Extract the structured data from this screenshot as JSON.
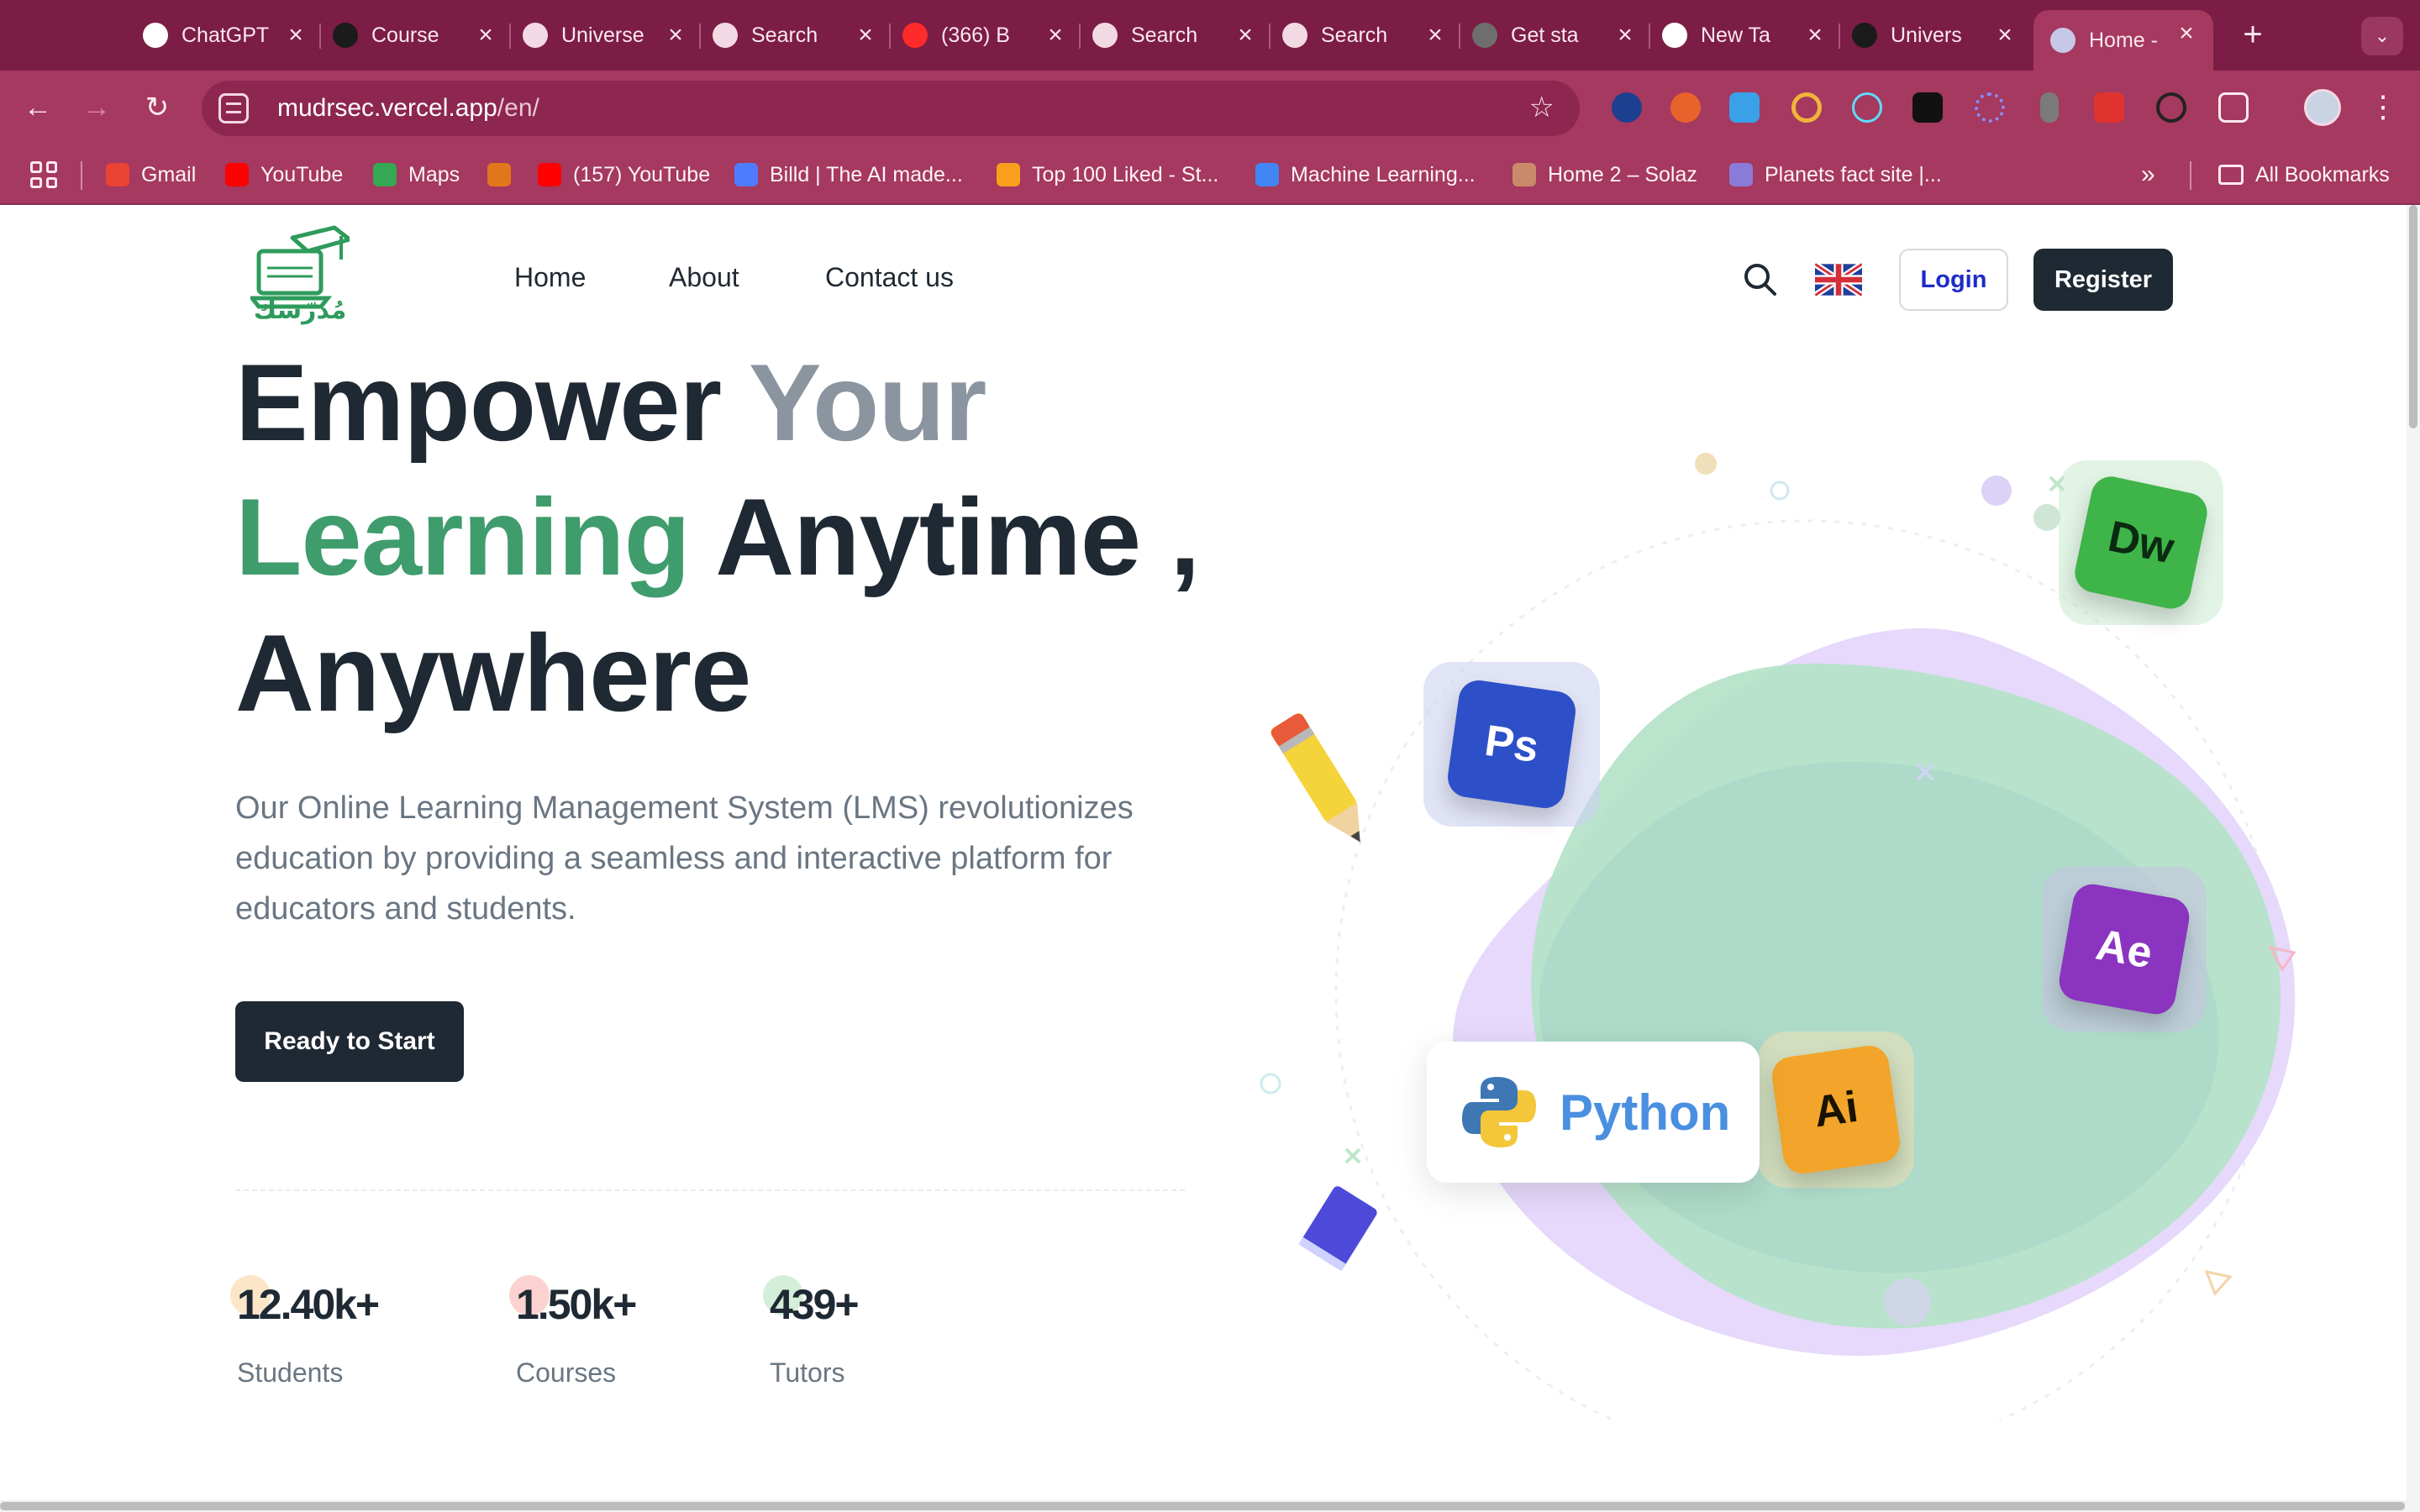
{
  "browser": {
    "tabs": [
      {
        "title": "ChatGPT",
        "favicon": "chatgpt-icon",
        "active": false
      },
      {
        "title": "Course",
        "favicon": "course-icon",
        "active": false
      },
      {
        "title": "Universe",
        "favicon": "openai-icon",
        "active": false
      },
      {
        "title": "Search",
        "favicon": "openai-icon",
        "active": false
      },
      {
        "title": "(366) B",
        "favicon": "youtube-icon",
        "active": false
      },
      {
        "title": "Search",
        "favicon": "openai-icon",
        "active": false
      },
      {
        "title": "Search",
        "favicon": "openai-icon",
        "active": false
      },
      {
        "title": "Get sta",
        "favicon": "globe-icon",
        "active": false
      },
      {
        "title": "New Ta",
        "favicon": "chrome-icon",
        "active": false
      },
      {
        "title": "Univers",
        "favicon": "course-icon",
        "active": false
      },
      {
        "title": "Home -",
        "favicon": "mudrsec-icon",
        "active": true
      }
    ],
    "url_host": "mudrsec.vercel.app",
    "url_path": "/en/",
    "bookmarks": [
      {
        "label": "Gmail",
        "icon": "gmail-icon",
        "color": "#ea4335"
      },
      {
        "label": "YouTube",
        "icon": "youtube-icon",
        "color": "#ff0000"
      },
      {
        "label": "Maps",
        "icon": "maps-icon",
        "color": "#34a853"
      },
      {
        "label": "",
        "icon": "fox-icon",
        "color": "#e2761b"
      },
      {
        "label": "(157) YouTube",
        "icon": "youtube-icon",
        "color": "#ff0000"
      },
      {
        "label": "Billd | The AI made...",
        "icon": "billd-icon",
        "color": "#4f7cff"
      },
      {
        "label": "Top 100 Liked - St...",
        "icon": "leetcode-icon",
        "color": "#f89f1b"
      },
      {
        "label": "Machine Learning...",
        "icon": "docs-icon",
        "color": "#4285f4"
      },
      {
        "label": "Home 2 – Solaz",
        "icon": "solaz-icon",
        "color": "#c98a6b"
      },
      {
        "label": "Planets fact site |...",
        "icon": "planets-icon",
        "color": "#8b7bd8"
      }
    ],
    "all_bookmarks_label": "All Bookmarks"
  },
  "site": {
    "logo_text": "مُدرّسك",
    "nav": [
      "Home",
      "About",
      "Contact us"
    ],
    "login_label": "Login",
    "register_label": "Register",
    "hero": {
      "line1_a": "Empower ",
      "line1_b": "Your",
      "line2_a": "Learning",
      "line2_b": " Anytime ,",
      "line3": "Anywhere"
    },
    "description": "Our Online Learning Management System (LMS) revolutionizes education by providing a seamless and interactive platform for educators and students.",
    "cta_label": "Ready to Start",
    "stats": [
      {
        "value": "12.40k+",
        "label": "Students",
        "dot_color": "#fde6c8"
      },
      {
        "value": "1.50k+",
        "label": "Courses",
        "dot_color": "#fbd2cf"
      },
      {
        "value": "439+",
        "label": "Tutors",
        "dot_color": "#d4efd9"
      }
    ],
    "apps": {
      "dw": "Dw",
      "ps": "Ps",
      "ae": "Ae",
      "ai": "Ai",
      "python": "Python"
    },
    "colors": {
      "brand_green": "#3f9c6d",
      "dark": "#1f2933",
      "chrome": "#a5395f"
    }
  }
}
